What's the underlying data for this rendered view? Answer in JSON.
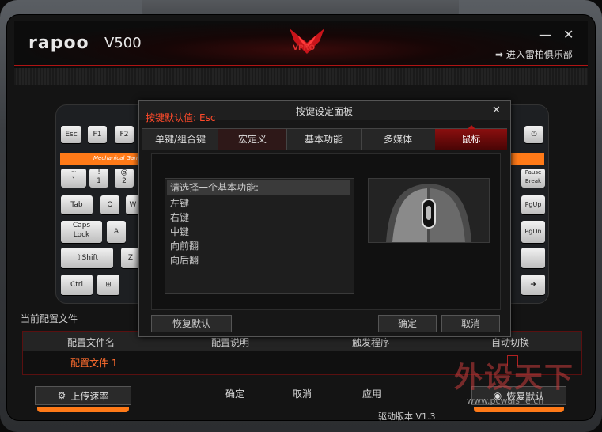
{
  "header": {
    "brand": "rapoo",
    "model": "V500",
    "logo_text": "VPRO",
    "club_link": "进入雷柏俱乐部",
    "minimize_glyph": "—",
    "close_glyph": "✕"
  },
  "keyboard": {
    "strip_text": "Mechanical Gaming",
    "keys": {
      "esc": "Esc",
      "f1": "F1",
      "f2": "F2",
      "tilde": "~\n`",
      "one": "!\n1",
      "two": "@\n2",
      "tab": "Tab",
      "caps": "Caps\nLock",
      "shift": "⇧Shift",
      "ctrl": "Ctrl",
      "q": "Q",
      "a": "A",
      "z": "Z",
      "w": "W",
      "pause": "Pause\nBreak",
      "pgup": "PgUp",
      "pgdn": "PgDn"
    }
  },
  "profiles": {
    "section_title": "当前配置文件",
    "columns": [
      "配置文件名",
      "配置说明",
      "触发程序",
      "自动切换"
    ],
    "rows": [
      {
        "name": "配置文件 1"
      }
    ]
  },
  "bottom": {
    "upload_label": "上传速率",
    "confirm": "确定",
    "cancel": "取消",
    "apply": "应用",
    "restore_label": "恢复默认",
    "version": "驱动版本 V1.3"
  },
  "watermark": {
    "text": "外设天下",
    "url": "www.pcwaishe.cn"
  },
  "dialog": {
    "title": "按键设定面板",
    "close_glyph": "✕",
    "default_label": "按键默认值:",
    "default_value": "Esc",
    "tabs": [
      "单键/组合键",
      "宏定义",
      "基本功能",
      "多媒体",
      "鼠标"
    ],
    "active_tab": "鼠标",
    "list_header": "请选择一个基本功能:",
    "list_items": [
      "左键",
      "右键",
      "中键",
      "向前翻",
      "向后翻"
    ],
    "restore_button": "恢复默认",
    "ok_button": "确定",
    "cancel_button": "取消"
  },
  "colors": {
    "accent": "#ff7a18",
    "brand_red": "#b01414",
    "active_tab": "#8a0f0f"
  }
}
